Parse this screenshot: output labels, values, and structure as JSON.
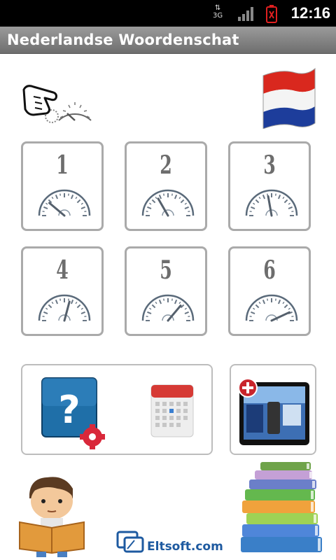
{
  "status_bar": {
    "network": "3G",
    "time": "12:16"
  },
  "app": {
    "title": "Nederlandse Woordenschat"
  },
  "levels": [
    {
      "label": "1",
      "needle_angle": -50
    },
    {
      "label": "2",
      "needle_angle": -30
    },
    {
      "label": "3",
      "needle_angle": -10
    },
    {
      "label": "4",
      "needle_angle": 15
    },
    {
      "label": "5",
      "needle_angle": 40
    },
    {
      "label": "6",
      "needle_angle": 65
    }
  ],
  "footer": {
    "brand": "Eltsoft.com"
  },
  "colors": {
    "flag_red": "#d9281e",
    "flag_white": "#ffffff",
    "flag_blue": "#1d3d9b",
    "help_blue": "#1f6fa8",
    "gear_red": "#d9283a",
    "calendar_red": "#d63a35",
    "brand_blue": "#1e5aa0"
  },
  "icons": [
    "pointer-hand-icon",
    "netherlands-flag-icon",
    "help-settings-icon",
    "calendar-icon",
    "more-apps-tablet-icon",
    "reading-boy-icon",
    "books-stack-icon"
  ]
}
